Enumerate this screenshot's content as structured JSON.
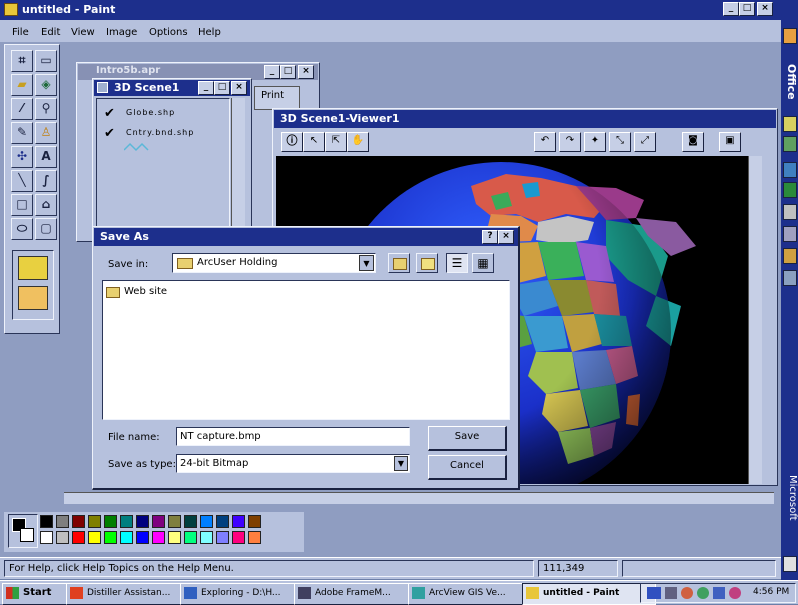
{
  "paint": {
    "title": "untitled - Paint",
    "menu": [
      "File",
      "Edit",
      "View",
      "Image",
      "Options",
      "Help"
    ],
    "status_help": "For Help, click Help Topics on the Help Menu.",
    "status_coords": "111,349"
  },
  "bg_window": {
    "title": "Intro5b.apr",
    "tab_label": "Print"
  },
  "scene_window": {
    "title": "3D Scene1",
    "layers": [
      {
        "name": "Globe.shp",
        "checked": true
      },
      {
        "name": "Cntry.bnd.shp",
        "checked": true
      }
    ]
  },
  "viewer": {
    "title": "3D Scene1-Viewer1"
  },
  "save_as": {
    "title": "Save As",
    "save_in_label": "Save in:",
    "save_in_value": "ArcUser Holding",
    "files": [
      "Web site"
    ],
    "file_name_label": "File name:",
    "file_name_value": "NT capture.bmp",
    "save_type_label": "Save as type:",
    "save_type_value": "24-bit Bitmap",
    "save_button": "Save",
    "cancel_button": "Cancel"
  },
  "palette_colors": [
    "#000000",
    "#7f7f7f",
    "#7f0000",
    "#7f7f00",
    "#007f00",
    "#007f7f",
    "#00007f",
    "#7f007f",
    "#7f7f3f",
    "#003f3f",
    "#007fff",
    "#003f7f",
    "#3f00ff",
    "#7f3f00",
    "#ffffff",
    "#bfbfbf",
    "#ff0000",
    "#ffff00",
    "#00ff00",
    "#00ffff",
    "#0000ff",
    "#ff00ff",
    "#ffff7f",
    "#00ff7f",
    "#7fffff",
    "#7f7fff",
    "#ff007f",
    "#ff7f3f"
  ],
  "office_bar": {
    "top_label": "Office",
    "bottom_label": "Microsoft"
  },
  "taskbar": {
    "start": "Start",
    "tasks": [
      "Distiller Assistan...",
      "Exploring - D:\\H...",
      "Adobe FrameM...",
      "ArcView GIS Ve...",
      "untitled - Paint"
    ],
    "clock": "4:56 PM"
  },
  "colors": {
    "active_title": "#1d2f8c",
    "chrome": "#b6c1dd",
    "desktop": "#6c7fa8"
  }
}
